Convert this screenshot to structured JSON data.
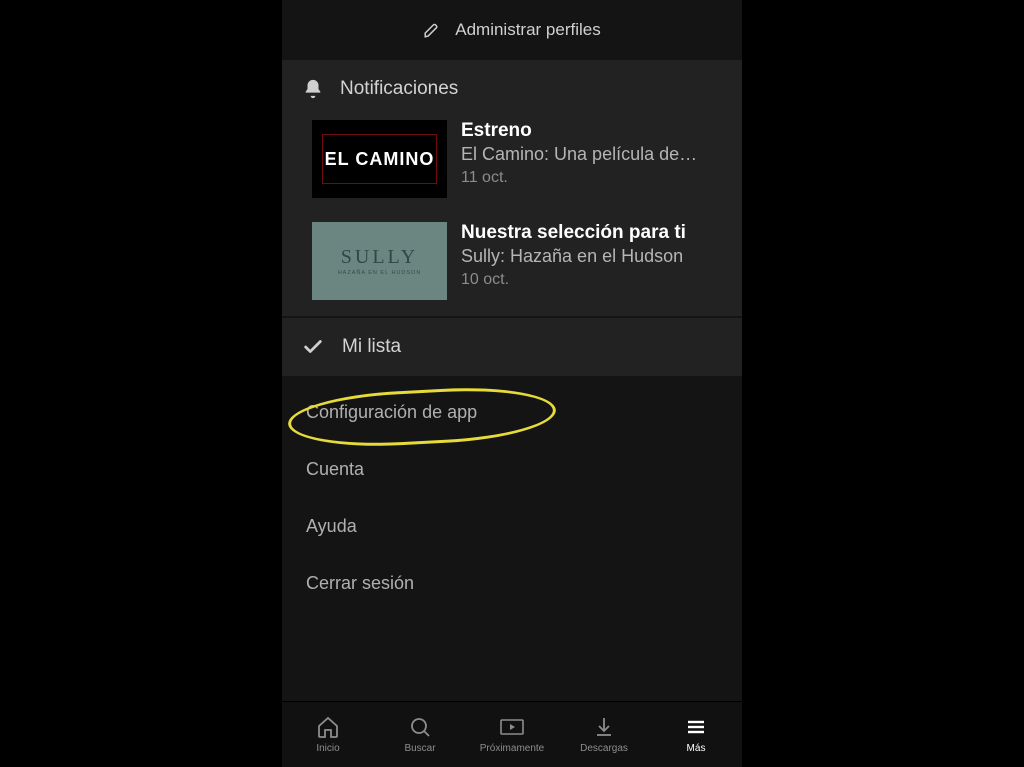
{
  "manage_profiles_label": "Administrar perfiles",
  "notifications": {
    "header_label": "Notificaciones",
    "items": [
      {
        "thumb_kind": "elcamino",
        "thumb_text_main": "EL CAMINO",
        "title": "Estreno",
        "subtitle": "El Camino: Una película de…",
        "date": "11 oct."
      },
      {
        "thumb_kind": "sully",
        "thumb_text_main": "SULLY",
        "thumb_text_sub": "HAZAÑA EN EL HUDSON",
        "title": "Nuestra selección para ti",
        "subtitle": "Sully: Hazaña en el Hudson",
        "date": "10 oct."
      }
    ]
  },
  "my_list_label": "Mi lista",
  "links": [
    {
      "label": "Configuración de app",
      "highlighted": true
    },
    {
      "label": "Cuenta",
      "highlighted": false
    },
    {
      "label": "Ayuda",
      "highlighted": false
    },
    {
      "label": "Cerrar sesión",
      "highlighted": false
    }
  ],
  "bottom_nav": [
    {
      "key": "home",
      "label": "Inicio",
      "active": false
    },
    {
      "key": "search",
      "label": "Buscar",
      "active": false
    },
    {
      "key": "coming",
      "label": "Próximamente",
      "active": false
    },
    {
      "key": "downloads",
      "label": "Descargas",
      "active": false
    },
    {
      "key": "more",
      "label": "Más",
      "active": true
    }
  ],
  "colors": {
    "highlight_ring": "#e6db3a",
    "bg_dark": "#141414",
    "bg_panel": "#222222"
  }
}
